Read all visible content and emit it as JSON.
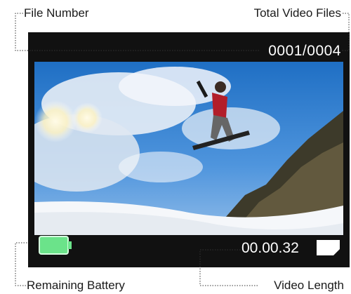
{
  "labels": {
    "file_number": "File Number",
    "total_video_files": "Total Video Files",
    "remaining_battery": "Remaining Battery",
    "video_length": "Video Length"
  },
  "screen": {
    "file_counter": "0001/0004",
    "video_time": "00.00.32"
  },
  "icons": {
    "battery": "battery-icon",
    "memory_card": "sd-card-icon"
  },
  "colors": {
    "screen_bg": "#111111",
    "battery_green": "#6be38a",
    "text_on_screen": "#ffffff",
    "leader_line": "#333333"
  }
}
